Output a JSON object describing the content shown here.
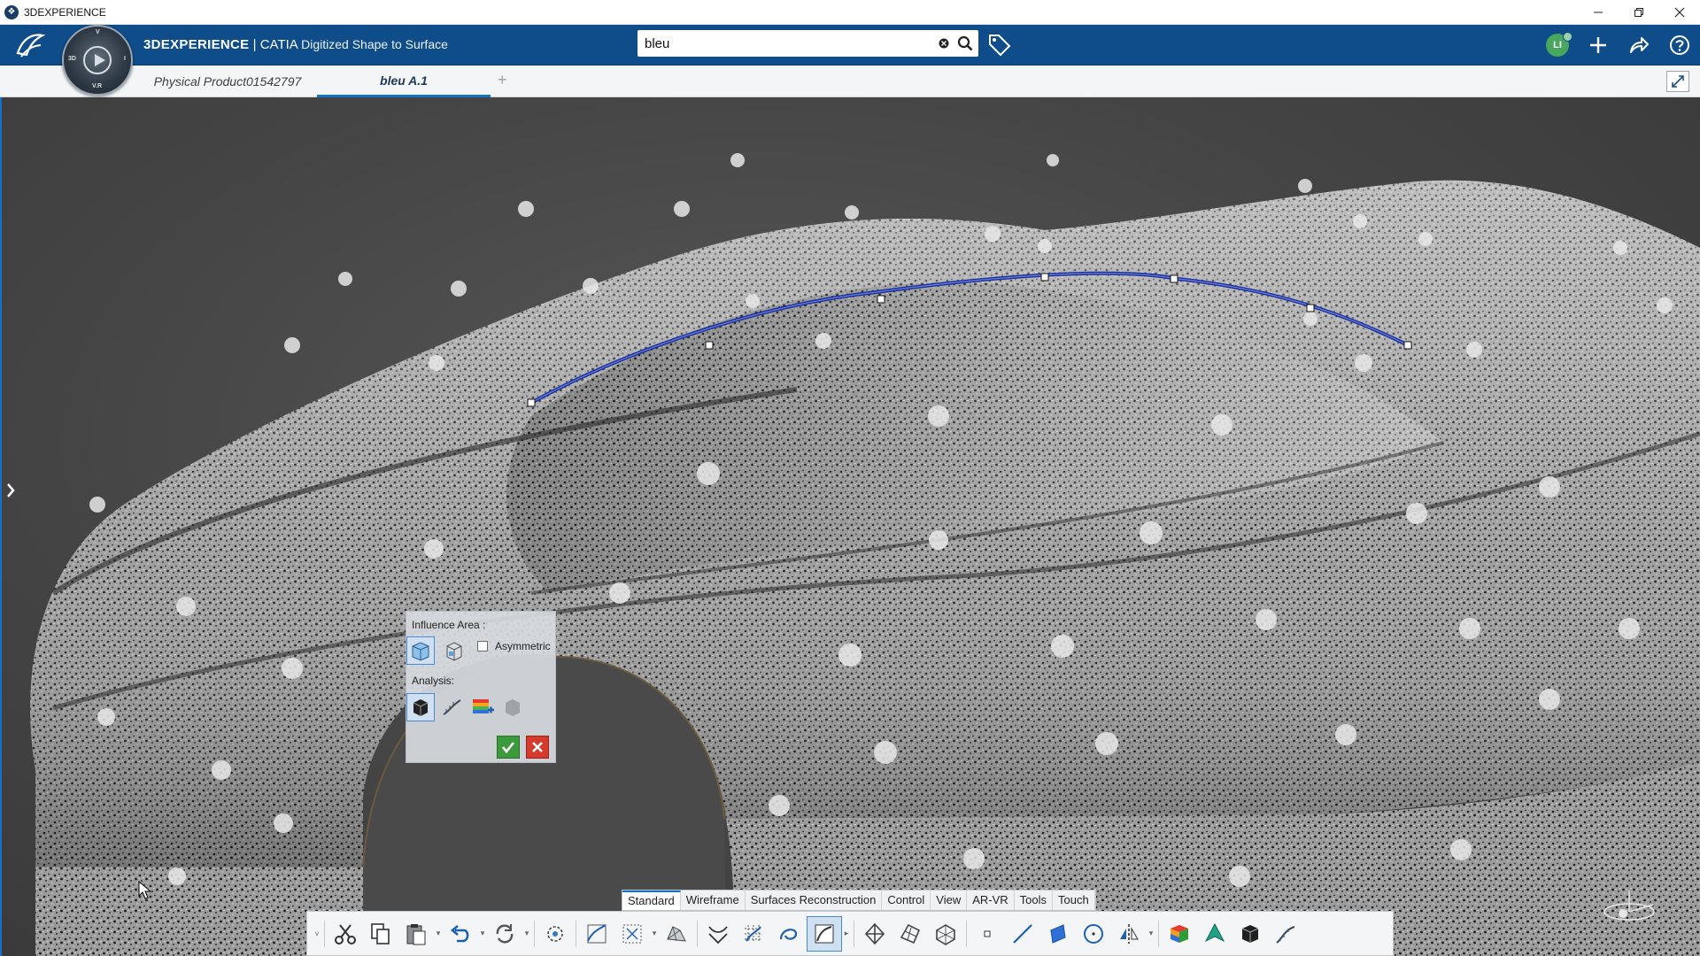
{
  "window": {
    "title": "3DEXPERIENCE",
    "controls": [
      "minimize",
      "restore",
      "close"
    ]
  },
  "topbar": {
    "brand_bold": "3DEXPERIENCE",
    "brand_sep": " | CATIA ",
    "brand_app": "Digitized Shape to Surface",
    "search_value": "bleu",
    "avatar_initials": "LI",
    "accent_color": "#0f4d8a"
  },
  "compass": {
    "top": "V",
    "left": "3D",
    "right": "I",
    "bottom": "V.R"
  },
  "tabs": [
    {
      "label": "Physical Product01542797",
      "active": false
    },
    {
      "label": "bleu A.1",
      "active": true
    }
  ],
  "tab_add": "+",
  "influence_panel": {
    "influence_label": "Influence Area :",
    "asymmetric_label": "Asymmetric",
    "asymmetric_checked": false,
    "analysis_label": "Analysis:"
  },
  "section_tabs": [
    "Standard",
    "Wireframe",
    "Surfaces Reconstruction",
    "Control",
    "View",
    "AR-VR",
    "Tools",
    "Touch"
  ],
  "active_section": "Standard",
  "actionbar_icons": [
    "cut-icon",
    "copy-icon",
    "paste-icon",
    "undo-icon",
    "update-icon",
    "snap-icon",
    "curve-on-mesh-icon",
    "mesh-select-icon",
    "mesh-edit-icon",
    "section-curves-icon",
    "cloud-grid-icon",
    "curve-loop-icon",
    "curve-active-icon",
    "network-icon",
    "surface-net-icon",
    "patch-icon",
    "point-icon",
    "line-icon",
    "plane-icon",
    "circle-icon",
    "symmetry-icon",
    "color-deviation-icon",
    "normal-analysis-icon",
    "shading-icon",
    "draft-curve-icon"
  ]
}
